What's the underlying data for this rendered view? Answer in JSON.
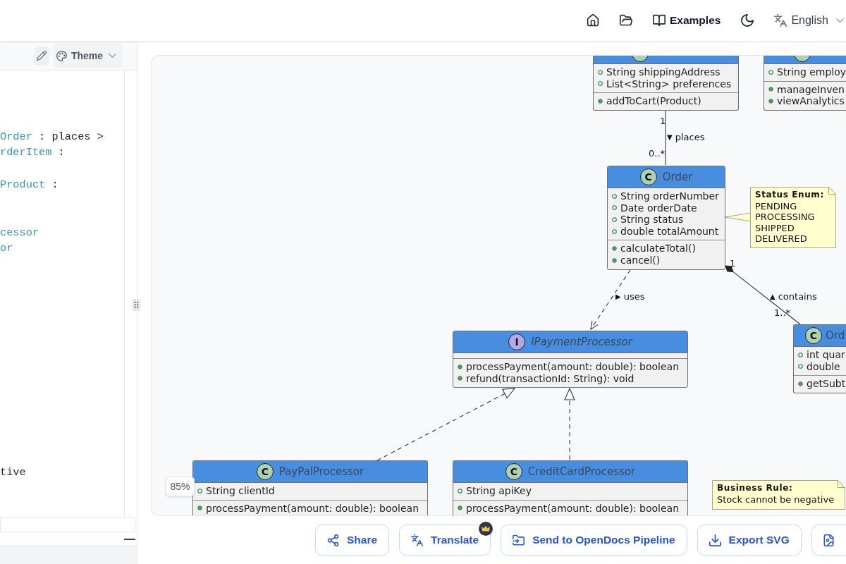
{
  "top_bar": {
    "examples_label": "Examples",
    "language": "English"
  },
  "editor": {
    "theme_label": "Theme",
    "lines": [
      {
        "kind": "blank"
      },
      {
        "kind": "blank"
      },
      {
        "kind": "blank"
      },
      {
        "kind": "code",
        "segments": [
          {
            "kind": "type",
            "text": "Order"
          },
          {
            "kind": "plain",
            "text": " : places >"
          }
        ]
      },
      {
        "kind": "code",
        "segments": [
          {
            "kind": "type",
            "text": "rderItem"
          },
          {
            "kind": "plain",
            "text": " :"
          }
        ]
      },
      {
        "kind": "blank"
      },
      {
        "kind": "code",
        "segments": [
          {
            "kind": "type",
            "text": "Product"
          },
          {
            "kind": "plain",
            "text": " :"
          }
        ]
      },
      {
        "kind": "blank"
      },
      {
        "kind": "blank"
      },
      {
        "kind": "code",
        "segments": [
          {
            "kind": "type",
            "text": "cessor"
          }
        ]
      },
      {
        "kind": "code",
        "segments": [
          {
            "kind": "type",
            "text": "or"
          }
        ]
      },
      {
        "kind": "blank"
      },
      {
        "kind": "blank"
      },
      {
        "kind": "blank"
      },
      {
        "kind": "blank"
      },
      {
        "kind": "blank"
      },
      {
        "kind": "blank"
      },
      {
        "kind": "blank"
      },
      {
        "kind": "blank"
      },
      {
        "kind": "blank"
      },
      {
        "kind": "blank"
      },
      {
        "kind": "blank"
      },
      {
        "kind": "blank"
      },
      {
        "kind": "blank"
      },
      {
        "kind": "code",
        "segments": [
          {
            "kind": "plain",
            "text": "tive"
          }
        ]
      }
    ]
  },
  "diagram": {
    "zoom_label": "85%",
    "classes": [
      {
        "kind": "class",
        "fields": [
          "String shippingAddress",
          "List<String> preferences"
        ],
        "methods": [
          "addToCart(Product)"
        ]
      },
      {
        "kind": "class",
        "fields": [
          "String employ"
        ],
        "methods": [
          "manageInven",
          "viewAnalytics"
        ]
      },
      {
        "kind": "class",
        "spot": "C",
        "name": "Order",
        "fields": [
          "String orderNumber",
          "Date orderDate",
          "String status",
          "double totalAmount"
        ],
        "methods": [
          "calculateTotal()",
          "cancel()"
        ]
      },
      {
        "kind": "interface",
        "spot": "I",
        "name": "IPaymentProcessor",
        "methods": [
          "processPayment(amount: double): boolean",
          "refund(transactionId: String): void"
        ]
      },
      {
        "kind": "class",
        "spot": "C",
        "name": "Ord",
        "fields": [
          "int quar",
          "double"
        ],
        "methods": [
          "getSubt"
        ]
      },
      {
        "kind": "class",
        "spot": "C",
        "name": "PayPalProcessor",
        "fields": [
          "String clientId"
        ],
        "methods": [
          "processPayment(amount: double): boolean"
        ]
      },
      {
        "kind": "class",
        "spot": "C",
        "name": "CreditCardProcessor",
        "fields": [
          "String apiKey"
        ],
        "methods": [
          "processPayment(amount: double): boolean"
        ]
      }
    ],
    "relations": [
      {
        "kind": "association",
        "source_multiplicity": "1",
        "label_arrow": "▼",
        "label": "places",
        "target_multiplicity": "0..*"
      },
      {
        "kind": "dependency",
        "label_arrow": "▶",
        "label": "uses"
      },
      {
        "kind": "composition",
        "source_multiplicity": "1",
        "label_arrow": "▲",
        "label": "contains",
        "target_multiplicity": "1..*"
      },
      {
        "kind": "realization"
      },
      {
        "kind": "realization"
      }
    ],
    "notes": [
      {
        "title": "Status Enum:",
        "lines": [
          "PENDING",
          "PROCESSING",
          "SHIPPED",
          "DELIVERED"
        ]
      },
      {
        "title": "Business Rule:",
        "lines": [
          "Stock cannot be negative"
        ]
      }
    ]
  },
  "actions": [
    {
      "label": "Share",
      "premium": false
    },
    {
      "label": "Translate",
      "premium": true
    },
    {
      "label": "Send to OpenDocs Pipeline",
      "premium": false
    },
    {
      "label": "Export SVG",
      "premium": false
    }
  ]
}
